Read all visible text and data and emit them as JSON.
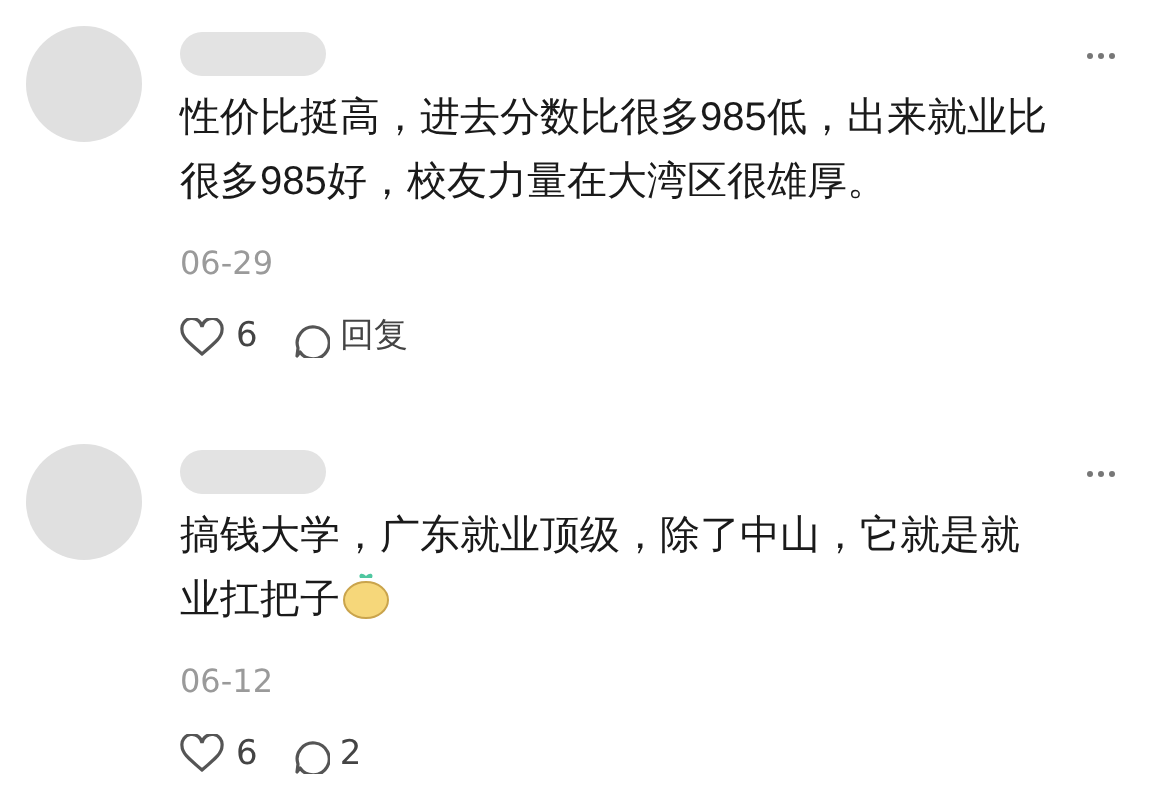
{
  "comments": [
    {
      "text": "性价比挺高，进去分数比很多985低，出来就业比很多985好，校友力量在大湾区很雄厚。",
      "sticker": false,
      "date": "06-29",
      "likes": "6",
      "reply": "回复"
    },
    {
      "text": "搞钱大学，广东就业顶级，除了中山，它就是就业扛把子",
      "sticker": true,
      "date": "06-12",
      "likes": "6",
      "reply": "2"
    }
  ]
}
